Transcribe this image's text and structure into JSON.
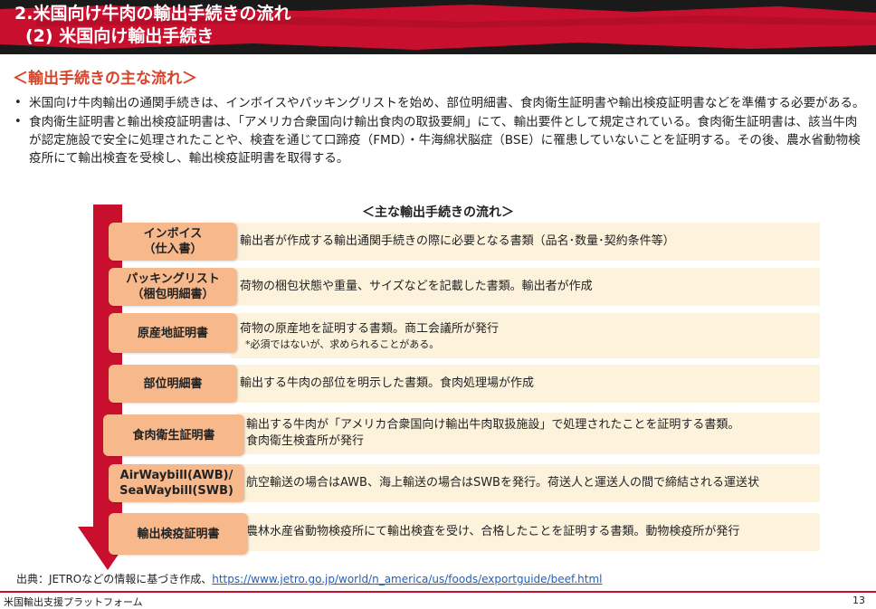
{
  "header": {
    "title_line1": "2.米国向け牛肉の輸出手続きの流れ",
    "title_line2": "(2) 米国向け輸出手続き"
  },
  "section_heading": "＜輸出手続きの主な流れ＞",
  "bullets": [
    "米国向け牛肉輸出の通関手続きは、インボイスやパッキングリストを始め、部位明細書、食肉衛生証明書や輸出検疫証明書などを準備する必要がある。",
    "食肉衛生証明書と輸出検疫証明書は、「アメリカ合衆国向け輸出食肉の取扱要綱」にて、輸出要件として規定されている。食肉衛生証明書は、該当牛肉が認定施設で安全に処理されたことや、検査を通じて口蹄疫（FMD）・牛海綿状脳症（BSE）に罹患していないことを証明する。その後、農水省動物検疫所にて輸出検査を受検し、輸出検疫証明書を取得する。"
  ],
  "bullet_marker": "•",
  "flow_title": "＜主な輸出手続きの流れ＞",
  "steps": [
    {
      "label_line1": "インボイス",
      "label_line2": "（仕入書）",
      "desc_line1": "輸出者が作成する輸出通関手続きの際に必要となる書類（品名･数量･契約条件等）",
      "desc_line2": "",
      "note": ""
    },
    {
      "label_line1": "パッキングリスト",
      "label_line2": "（梱包明細書）",
      "desc_line1": "荷物の梱包状態や重量、サイズなどを記載した書類。輸出者が作成",
      "desc_line2": "",
      "note": ""
    },
    {
      "label_line1": "原産地証明書",
      "label_line2": "",
      "desc_line1": "荷物の原産地を証明する書類。商工会議所が発行",
      "desc_line2": "",
      "note": "*必須ではないが、求められることがある。"
    },
    {
      "label_line1": "部位明細書",
      "label_line2": "",
      "desc_line1": "輸出する牛肉の部位を明示した書類。食肉処理場が作成",
      "desc_line2": "",
      "note": ""
    },
    {
      "label_line1": "食肉衛生証明書",
      "label_line2": "",
      "desc_line1": "輸出する牛肉が「アメリカ合衆国向け輸出牛肉取扱施設」で処理されたことを証明する書類。",
      "desc_line2": "食肉衛生検査所が発行",
      "note": ""
    },
    {
      "label_line1": "AirWaybill(AWB)/",
      "label_line2": "SeaWaybill(SWB)",
      "desc_line1": "航空輸送の場合はAWB、海上輸送の場合はSWBを発行。荷送人と運送人の間で締結される運送状",
      "desc_line2": "",
      "note": ""
    },
    {
      "label_line1": "輸出検疫証明書",
      "label_line2": "",
      "desc_line1": "農林水産省動物検疫所にて輸出検査を受け、合格したことを証明する書類。動物検疫所が発行",
      "desc_line2": "",
      "note": ""
    }
  ],
  "source": {
    "prefix": "出典：JETROなどの情報に基づき作成、",
    "link_text": "https://www.jetro.go.jp/world/n_america/us/foods/exportguide/beef.html"
  },
  "footer": {
    "left": "米国輸出支援プラットフォーム",
    "page_number": "13"
  },
  "colors": {
    "accent_red": "#c8102e",
    "heading_orange": "#d6442a",
    "step_box": "#f7b98c",
    "step_desc_bg": "#fdf3dc",
    "header_bg": "#1a1a1a"
  }
}
